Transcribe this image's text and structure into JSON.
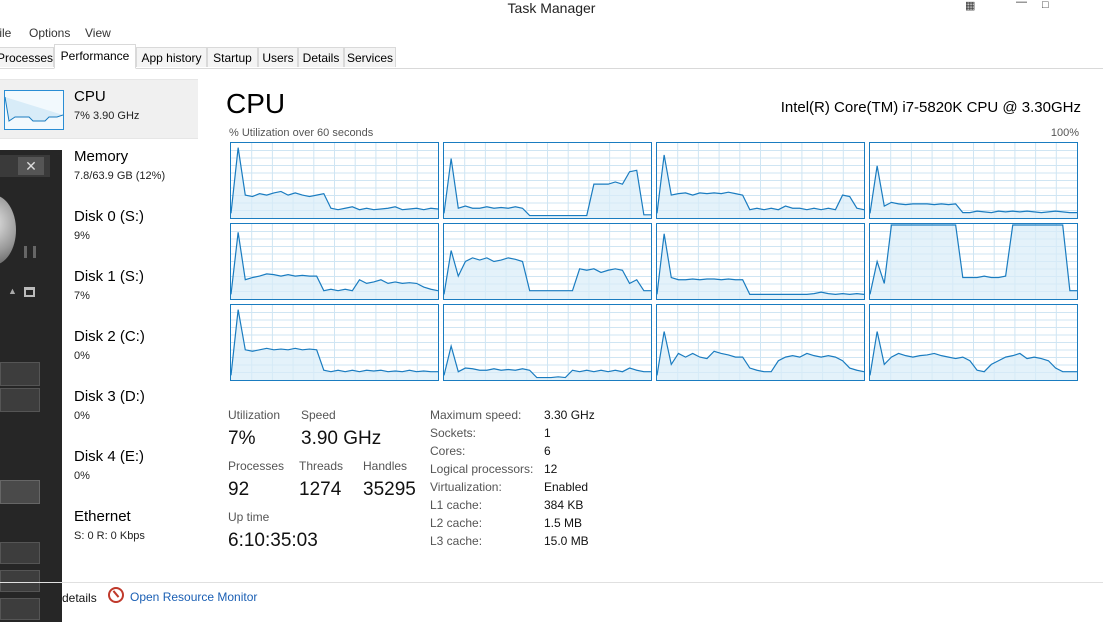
{
  "window": {
    "title": "Task Manager"
  },
  "menu": {
    "file": "File",
    "options": "Options",
    "view": "View"
  },
  "tabs": [
    {
      "label": "Processes",
      "active": false
    },
    {
      "label": "Performance",
      "active": true
    },
    {
      "label": "App history",
      "active": false
    },
    {
      "label": "Startup",
      "active": false
    },
    {
      "label": "Users",
      "active": false
    },
    {
      "label": "Details",
      "active": false
    },
    {
      "label": "Services",
      "active": false
    }
  ],
  "sidebar": {
    "items": [
      {
        "name": "CPU",
        "value": "7% 3.90 GHz",
        "selected": true
      },
      {
        "name": "Memory",
        "value": "7.8/63.9 GB (12%)"
      },
      {
        "name": "Disk 0 (S:)",
        "value": "9%"
      },
      {
        "name": "Disk 1 (S:)",
        "value": "7%"
      },
      {
        "name": "Disk 2 (C:)",
        "value": "0%"
      },
      {
        "name": "Disk 3 (D:)",
        "value": "0%"
      },
      {
        "name": "Disk 4 (E:)",
        "value": "0%"
      },
      {
        "name": "Ethernet",
        "value": "S: 0 R: 0 Kbps"
      }
    ]
  },
  "main": {
    "title": "CPU",
    "model": "Intel(R) Core(TM) i7-5820K CPU @ 3.30GHz",
    "graph_label": "% Utilization over 60 seconds",
    "graph_max": "100%",
    "stats": {
      "utilization_label": "Utilization",
      "utilization": "7%",
      "speed_label": "Speed",
      "speed": "3.90 GHz",
      "processes_label": "Processes",
      "processes": "92",
      "threads_label": "Threads",
      "threads": "1274",
      "handles_label": "Handles",
      "handles": "35295",
      "uptime_label": "Up time",
      "uptime": "6:10:35:03"
    },
    "details": [
      {
        "label": "Maximum speed:",
        "value": "3.30 GHz"
      },
      {
        "label": "Sockets:",
        "value": "1"
      },
      {
        "label": "Cores:",
        "value": "6"
      },
      {
        "label": "Logical processors:",
        "value": "12"
      },
      {
        "label": "Virtualization:",
        "value": "Enabled"
      },
      {
        "label": "L1 cache:",
        "value": "384 KB"
      },
      {
        "label": "L2 cache:",
        "value": "1.5 MB"
      },
      {
        "label": "L3 cache:",
        "value": "15.0 MB"
      }
    ]
  },
  "footer": {
    "fewer_details": "details",
    "resource_monitor": "Open Resource Monitor"
  },
  "colors": {
    "graph_line": "#1a7cc0",
    "graph_fill": "#d8ecf8",
    "grid": "#cfe5f3",
    "link": "#1a5fb4"
  },
  "cpu_graphs": [
    [
      5,
      95,
      30,
      28,
      32,
      30,
      33,
      35,
      30,
      33,
      30,
      28,
      30,
      32,
      12,
      10,
      12,
      14,
      10,
      12,
      10,
      11,
      12,
      14,
      10,
      11,
      12,
      10,
      12,
      11
    ],
    [
      5,
      80,
      12,
      15,
      12,
      12,
      14,
      12,
      13,
      12,
      14,
      12,
      2,
      2,
      2,
      2,
      2,
      2,
      2,
      2,
      2,
      45,
      45,
      45,
      48,
      45,
      62,
      64,
      3,
      3
    ],
    [
      5,
      85,
      30,
      32,
      33,
      30,
      33,
      32,
      33,
      32,
      34,
      32,
      30,
      10,
      12,
      10,
      12,
      10,
      15,
      12,
      12,
      10,
      12,
      10,
      12,
      10,
      30,
      28,
      12,
      10
    ],
    [
      5,
      70,
      15,
      20,
      18,
      17,
      18,
      18,
      18,
      17,
      18,
      17,
      18,
      6,
      6,
      8,
      7,
      6,
      8,
      7,
      8,
      7,
      8,
      7,
      6,
      7,
      8,
      7,
      6,
      6
    ],
    [
      5,
      90,
      25,
      28,
      30,
      33,
      32,
      30,
      32,
      30,
      31,
      30,
      30,
      10,
      12,
      10,
      12,
      10,
      25,
      20,
      22,
      25,
      20,
      22,
      20,
      21,
      20,
      15,
      12,
      10
    ],
    [
      5,
      65,
      30,
      50,
      55,
      52,
      55,
      50,
      52,
      55,
      53,
      50,
      10,
      10,
      10,
      10,
      10,
      10,
      10,
      40,
      38,
      40,
      35,
      38,
      40,
      38,
      20,
      25,
      10,
      10
    ],
    [
      5,
      88,
      28,
      25,
      25,
      26,
      25,
      26,
      26,
      25,
      26,
      25,
      25,
      5,
      5,
      5,
      5,
      5,
      5,
      5,
      5,
      5,
      6,
      8,
      6,
      5,
      6,
      5,
      6,
      5
    ],
    [
      5,
      50,
      20,
      100,
      100,
      100,
      100,
      100,
      100,
      100,
      100,
      100,
      100,
      28,
      28,
      28,
      30,
      28,
      28,
      30,
      100,
      100,
      100,
      100,
      100,
      100,
      100,
      100,
      10,
      10
    ],
    [
      5,
      95,
      40,
      38,
      40,
      42,
      40,
      41,
      40,
      42,
      40,
      41,
      40,
      12,
      10,
      12,
      10,
      12,
      10,
      12,
      11,
      12,
      10,
      11,
      10,
      12,
      10,
      11,
      10,
      10
    ],
    [
      5,
      45,
      10,
      15,
      14,
      12,
      12,
      14,
      12,
      13,
      12,
      14,
      12,
      2,
      2,
      2,
      3,
      2,
      12,
      10,
      12,
      10,
      12,
      10,
      12,
      10,
      15,
      12,
      10,
      10
    ],
    [
      5,
      65,
      20,
      35,
      30,
      35,
      30,
      28,
      38,
      35,
      33,
      30,
      30,
      15,
      12,
      10,
      10,
      25,
      30,
      32,
      30,
      35,
      32,
      30,
      32,
      30,
      25,
      15,
      12,
      10
    ],
    [
      5,
      65,
      20,
      30,
      35,
      32,
      30,
      32,
      33,
      35,
      32,
      30,
      28,
      30,
      25,
      12,
      10,
      20,
      25,
      30,
      32,
      35,
      28,
      30,
      28,
      25,
      15,
      10,
      10,
      10
    ]
  ]
}
